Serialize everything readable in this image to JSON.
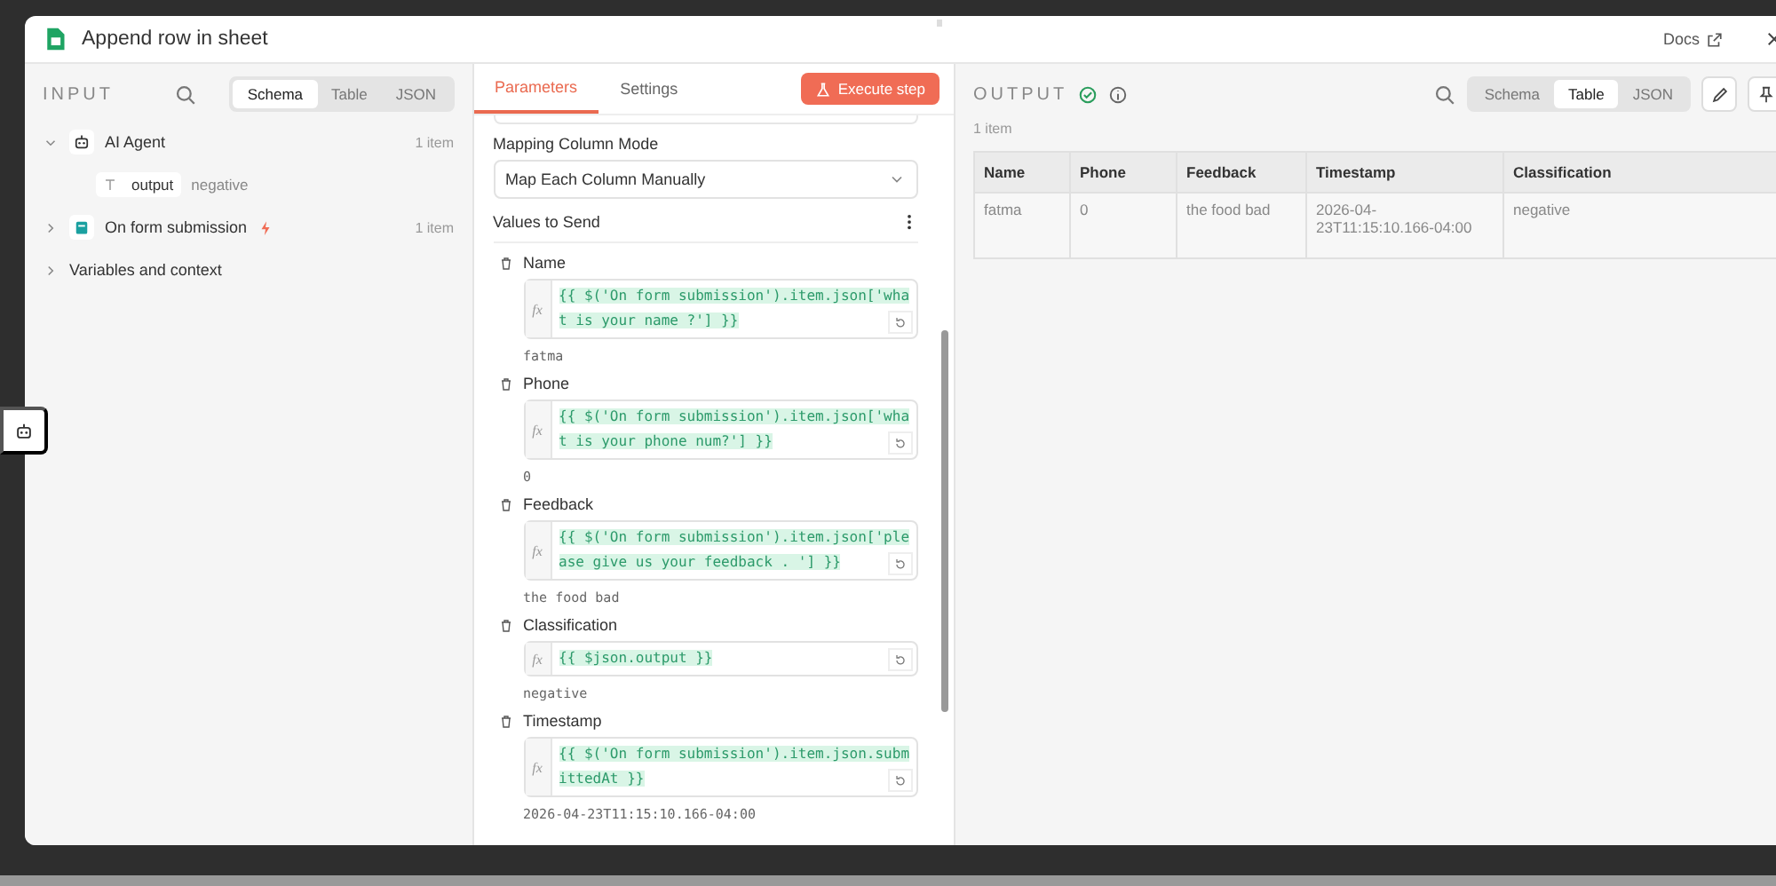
{
  "window": {
    "title": "Append row in sheet",
    "docs_link": "Docs"
  },
  "input_panel": {
    "heading": "INPUT",
    "view_tabs": [
      {
        "label": "Schema",
        "selected": true
      },
      {
        "label": "Table",
        "selected": false
      },
      {
        "label": "JSON",
        "selected": false
      }
    ],
    "items": [
      {
        "kind": "agent",
        "label": "AI Agent",
        "count": "1 item",
        "expanded": true,
        "children": [
          {
            "label": "output",
            "value": "negative"
          }
        ]
      },
      {
        "kind": "form",
        "label": "On form submission",
        "count": "1 item",
        "expanded": false,
        "trigger": true
      },
      {
        "kind": "group",
        "label": "Variables and context",
        "expanded": false
      }
    ]
  },
  "parameters_panel": {
    "tabs": [
      {
        "label": "Parameters",
        "selected": true
      },
      {
        "label": "Settings",
        "selected": false
      }
    ],
    "execute_button": "Execute step",
    "mapping_label": "Mapping Column Mode",
    "mapping_value": "Map Each Column Manually",
    "values_heading": "Values to Send",
    "fields": [
      {
        "mode_label": "fx",
        "name": "Name",
        "expression": "{{ $('On form submission').item.json['what is your name ?'] }}",
        "result": "fatma"
      },
      {
        "mode_label": "fx",
        "name": "Phone",
        "expression": "{{ $('On form submission').item.json['what is your phone num?'] }}",
        "result": "0"
      },
      {
        "mode_label": "fx",
        "name": "Feedback",
        "expression": "{{ $('On form submission').item.json['please give us your feedback . '] }}",
        "result": "the food bad"
      },
      {
        "mode_label": "fx",
        "name": "Classification",
        "expression": "{{ $json.output }}",
        "result": "negative"
      },
      {
        "mode_label": "fx",
        "name": "Timestamp",
        "expression": "{{ $('On form submission').item.json.submittedAt }}",
        "result": "2026-04-23T11:15:10.166-04:00"
      }
    ]
  },
  "output_panel": {
    "heading": "OUTPUT",
    "success": true,
    "item_count": "1 item",
    "view_tabs": [
      {
        "label": "Schema",
        "selected": false
      },
      {
        "label": "Table",
        "selected": true
      },
      {
        "label": "JSON",
        "selected": false
      }
    ],
    "table": {
      "columns": [
        "Name",
        "Phone",
        "Feedback",
        "Timestamp",
        "Classification"
      ],
      "rows": [
        [
          "fatma",
          "0",
          "the food bad",
          "2026-04-23T11:15:10.166-04:00",
          "negative"
        ]
      ]
    }
  }
}
